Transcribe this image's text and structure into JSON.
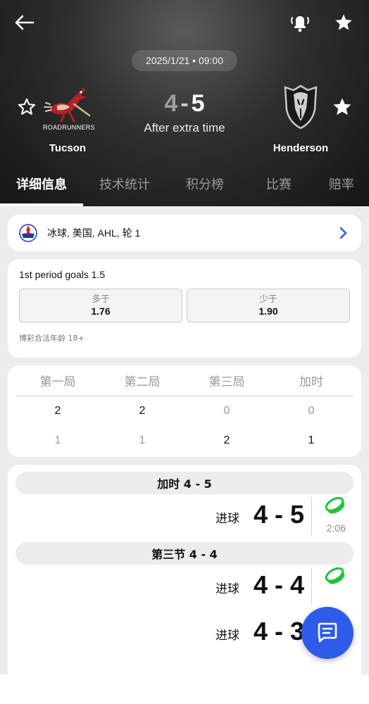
{
  "header": {
    "date_time": "2025/1/21 • 09:00",
    "status_text": "After extra time",
    "home": {
      "name": "Tucson",
      "logo_text": "ROADRUNNERS",
      "score": "4"
    },
    "away": {
      "name": "Henderson",
      "score": "5"
    },
    "score_separator": "-"
  },
  "tabs": [
    {
      "label": "详细信息",
      "active": true
    },
    {
      "label": "技术统计",
      "active": false
    },
    {
      "label": "积分榜",
      "active": false
    },
    {
      "label": "比赛",
      "active": false
    },
    {
      "label": "赔率",
      "active": false
    }
  ],
  "league": {
    "text": "冰球, 美国, AHL, 轮 1"
  },
  "odds": {
    "title": "1st period goals 1.5",
    "over": {
      "label": "多于",
      "value": "1.76"
    },
    "under": {
      "label": "少于",
      "value": "1.90"
    },
    "note": "博彩合法年龄 18+"
  },
  "periods": {
    "headers": [
      "第一局",
      "第二局",
      "第三局",
      "加时"
    ],
    "home": [
      "2",
      "2",
      "0",
      "0"
    ],
    "away": [
      "1",
      "1",
      "2",
      "1"
    ]
  },
  "events": {
    "sections": [
      {
        "title": "加时 4 - 5",
        "label": "进球",
        "score": "4 - 5",
        "time": "2:06"
      },
      {
        "title": "第三节 4 - 4",
        "label": "进球",
        "score": "4 - 4",
        "time": ""
      }
    ],
    "partial_row": {
      "label": "进球",
      "score": "4 - 3"
    }
  },
  "colors": {
    "accent": "#2f5bea",
    "goal_icon": "#1ec43a",
    "header_bg": "#222222"
  },
  "icons": [
    "back-arrow-icon",
    "alarm-bell-icon",
    "star-icon",
    "chevron-right-icon",
    "puck-icon",
    "chat-icon"
  ]
}
